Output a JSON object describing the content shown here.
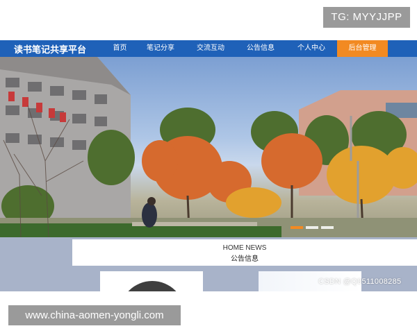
{
  "overlay": {
    "tg_label": "TG: MYYJJPP",
    "url_label": "www.china-aomen-yongli.com"
  },
  "site": {
    "brand": "读书笔记共享平台",
    "nav": [
      {
        "label": "首页",
        "active": false
      },
      {
        "label": "笔记分享",
        "active": false
      },
      {
        "label": "交流互动",
        "active": false
      },
      {
        "label": "公告信息",
        "active": false
      },
      {
        "label": "个人中心",
        "active": false
      },
      {
        "label": "后台管理",
        "active": true
      }
    ],
    "colors": {
      "nav_bg": "#1f61b8",
      "nav_active": "#f28a22"
    }
  },
  "hero": {
    "image_alt": "campus-autumn-photo",
    "carousel_dots": 3,
    "active_dot": 0
  },
  "news": {
    "title_en": "HOME NEWS",
    "title_zh": "公告信息"
  },
  "watermark": "CSDN @Q0511008285"
}
